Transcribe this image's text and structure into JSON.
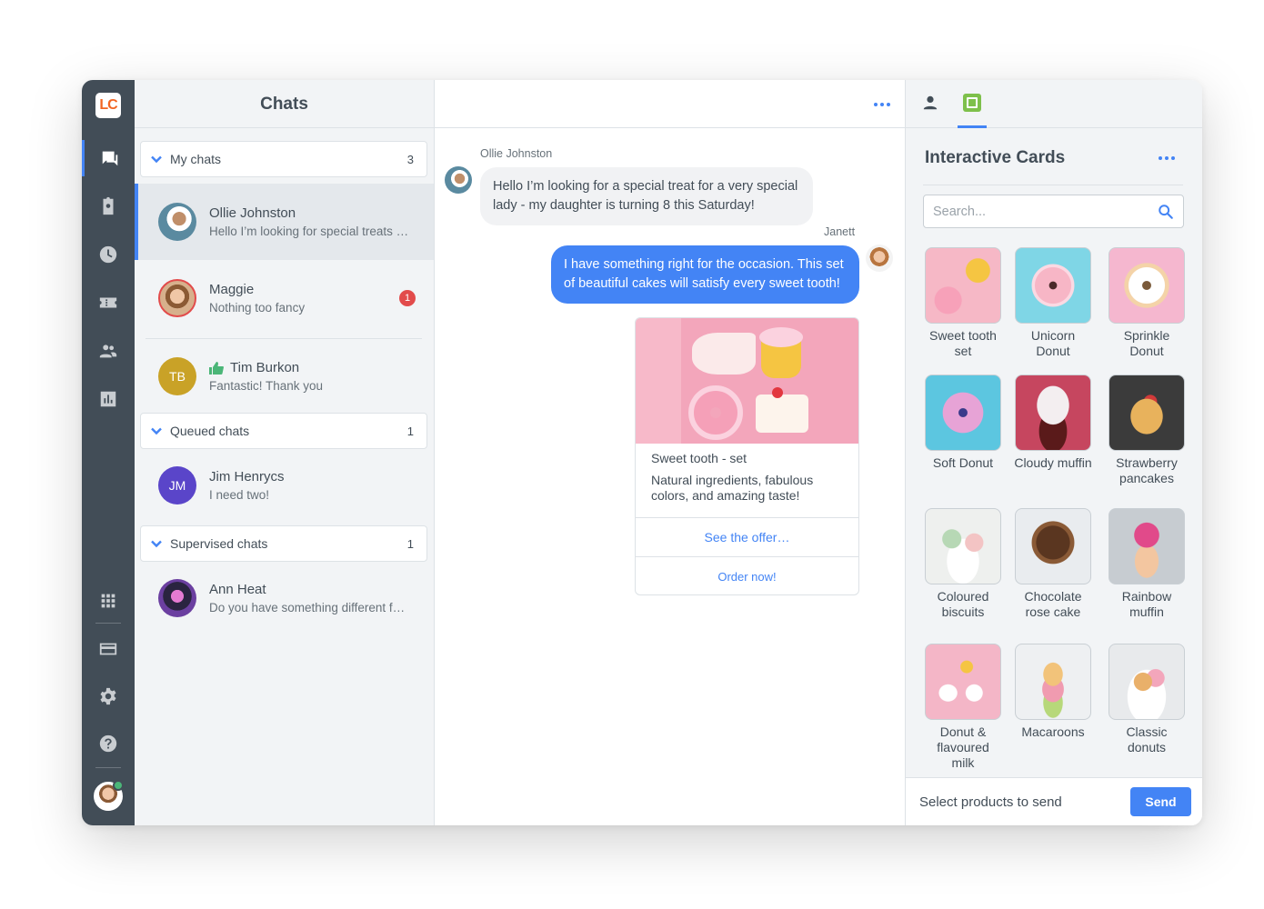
{
  "app": {
    "logo_text": "LC"
  },
  "chats_column": {
    "title": "Chats",
    "groups": [
      {
        "label": "My chats",
        "count": "3"
      },
      {
        "label": "Queued chats",
        "count": "1"
      },
      {
        "label": "Supervised chats",
        "count": "1"
      }
    ],
    "items": [
      {
        "name": "Ollie Johnston",
        "message": "Hello I’m looking for special treats for my daughter",
        "active": true
      },
      {
        "name": "Maggie",
        "message": "Nothing too fancy",
        "badge": "1"
      },
      {
        "name": "Tim Burkon",
        "initials": "TB",
        "message": "Fantastic! Thank you",
        "rating_icon": "thumbs-up-icon"
      },
      {
        "name": "Jim Henrycs",
        "initials": "JM",
        "message": "I need two!"
      },
      {
        "name": "Ann Heat",
        "message": "Do you have something different for my birthday?"
      }
    ]
  },
  "conversation": {
    "messages": [
      {
        "author": "Ollie Johnston",
        "text": "Hello I’m looking for a special treat for a very special lady - my daughter is turning 8 this Saturday!",
        "direction": "in"
      },
      {
        "author": "Janett",
        "text": "I have something right for the occasion. This set of beautiful cakes will satisfy every sweet tooth!",
        "direction": "out"
      }
    ],
    "card": {
      "title": "Sweet tooth - set",
      "description": "Natural ingredients, fabulous colors, and amazing taste!",
      "buttons": [
        "See the offer…",
        "Order now!"
      ]
    }
  },
  "panel": {
    "title": "Interactive Cards",
    "search_placeholder": "Search...",
    "products": [
      {
        "name": "Sweet tooth set",
        "color": "#f6b8c6"
      },
      {
        "name": "Unicorn Donut",
        "color": "#7fd6e6"
      },
      {
        "name": "Sprinkle Donut",
        "color": "#f5b7cf"
      },
      {
        "name": "Soft Donut",
        "color": "#5cc6e0"
      },
      {
        "name": "Cloudy muffin",
        "color": "#c6465f"
      },
      {
        "name": "Strawberry pancakes",
        "color": "#3b3b3b"
      },
      {
        "name": "Coloured biscuits",
        "color": "#eef0ee"
      },
      {
        "name": "Chocolate rose cake",
        "color": "#e9ecef"
      },
      {
        "name": "Rainbow muffin",
        "color": "#c7ccd1"
      },
      {
        "name": "Donut & flavoured milk",
        "color": "#f4b6c7"
      },
      {
        "name": "Macaroons",
        "color": "#eef0f2"
      },
      {
        "name": "Classic donuts",
        "color": "#e8eaec"
      }
    ],
    "footer_label": "Select products to send",
    "send_label": "Send"
  },
  "colors": {
    "accent": "#4384f5",
    "rail": "#424d57",
    "badge": "#e24b4b",
    "online": "#4bb678"
  }
}
